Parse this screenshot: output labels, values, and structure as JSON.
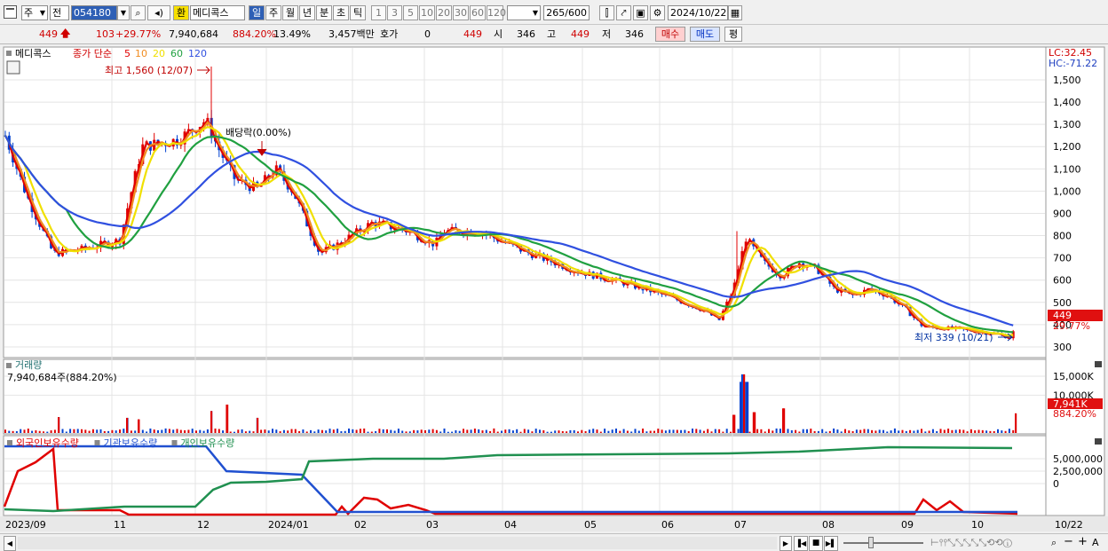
{
  "toolbar": {
    "market": "주",
    "prev_label": "전",
    "code": "054180",
    "name_badge": "환",
    "stock_name": "메디콕스",
    "periods": [
      "일",
      "주",
      "월",
      "년",
      "분",
      "초",
      "틱"
    ],
    "active_period": "일",
    "intervals": [
      "1",
      "3",
      "5",
      "10",
      "20",
      "30",
      "60",
      "120"
    ],
    "count": "265",
    "count_max": "/600",
    "date": "2024/10/22"
  },
  "info": {
    "price": "449",
    "change": "103",
    "change_pct": "+29.77%",
    "volume": "7,940,684",
    "volume_pct": "884.20%",
    "turnover": "13.49%",
    "amount": "3,457백만",
    "quote_label": "호가",
    "quote_value": "0",
    "quote_price": "449",
    "open_label": "시",
    "open": "346",
    "high_label": "고",
    "high": "449",
    "low_label": "저",
    "low": "346",
    "buy_label": "매수",
    "sell_label": "매도",
    "eval_label": "평"
  },
  "price_panel": {
    "name": "메디콕스",
    "ma_label": "종가 단순",
    "ma_periods": [
      "5",
      "10",
      "20",
      "60",
      "120"
    ],
    "ma_colors": [
      "#e00000",
      "#f08c20",
      "#f0e000",
      "#20a040",
      "#3050e0"
    ],
    "lc": "LC:32.45",
    "hc": "HC:-71.22",
    "high_note": "최고 1,560 (12/07)",
    "low_note": "최저 339 (10/21)",
    "dividend_note": "배당락(0.00%)",
    "current_tag": "449",
    "current_pct": "29.77%",
    "y_ticks": [
      "1,500",
      "1,400",
      "1,300",
      "1,200",
      "1,100",
      "1,000",
      "900",
      "800",
      "700",
      "600",
      "500",
      "400",
      "300"
    ]
  },
  "volume_panel": {
    "title": "거래량",
    "subtitle": "7,940,684주(884.20%)",
    "y_ticks": [
      "15,000K",
      "10,000K"
    ],
    "current_tag": "7,941K",
    "current_pct": "884.20%"
  },
  "holding_panel": {
    "legends": [
      "외국인보유수량",
      "기관보유수량",
      "개인보유수량"
    ],
    "legend_colors": [
      "#e00000",
      "#2050d0",
      "#209050"
    ],
    "y_ticks": [
      "5,000,000",
      "2,500,000",
      "0"
    ]
  },
  "x_axis": {
    "labels": [
      "2023/09",
      "11",
      "12",
      "2024/01",
      "02",
      "03",
      "04",
      "05",
      "06",
      "07",
      "08",
      "09",
      "10",
      "10/22"
    ]
  }
}
